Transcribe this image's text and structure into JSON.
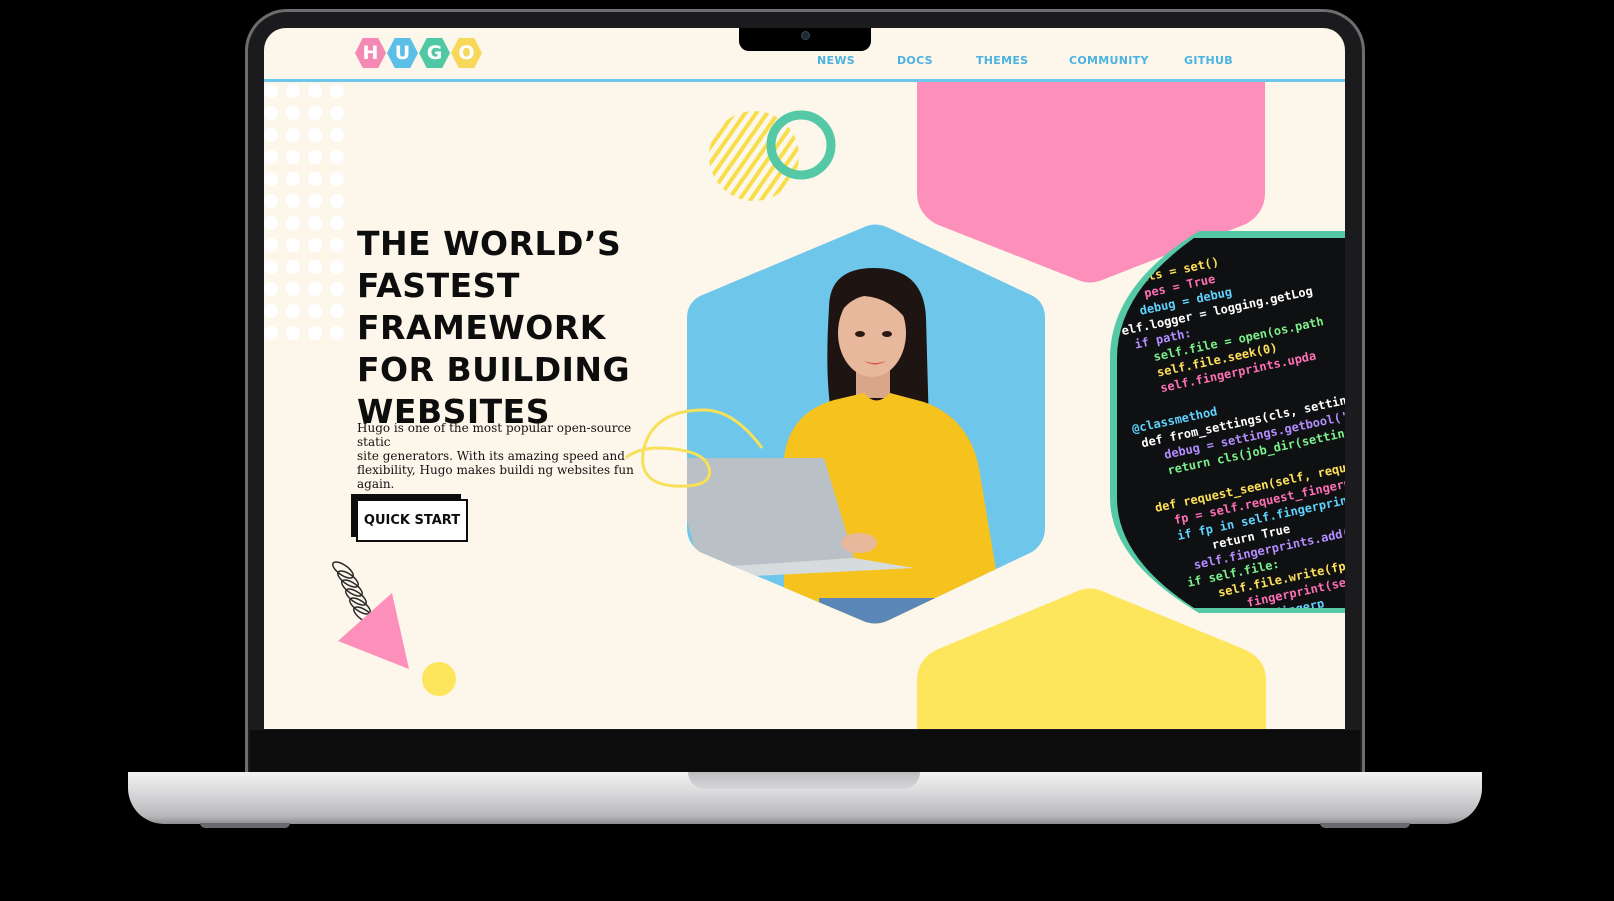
{
  "logo": {
    "letters": [
      "H",
      "U",
      "G",
      "O"
    ],
    "colors": [
      "#f489b6",
      "#5bbfe8",
      "#50c8a4",
      "#f7d85b"
    ]
  },
  "nav": {
    "news": "NEWS",
    "docs": "DOCS",
    "themes": "THEMES",
    "community": "COMMUNITY",
    "github": "GITHUB"
  },
  "hero": {
    "headline_lines": [
      "THE WORLD’S",
      "FASTEST FRAMEWORK",
      "FOR BUILDING",
      "WEBSITES"
    ],
    "description_lines": [
      "Hugo is one of the most popular open-source static",
      "site generators. With its amazing speed and",
      "flexibility, Hugo makes buildi ng websites fun again."
    ],
    "cta_label": "QUICK START"
  },
  "colors": {
    "background": "#fdf6ea",
    "pink": "#fd8fbb",
    "blue": "#6ec6ea",
    "green": "#55c9a5",
    "yellow": "#fee65c",
    "nav_text": "#4ab3e0"
  },
  "code_lines": [
    "nts = set()",
    "pes = True",
    "debug = debug",
    "elf.logger = logging.getLog",
    "if path:",
    "self.file = open(os.path",
    "self.file.seek(0)",
    "self.fingerprints.upda",
    "@classmethod",
    "def from_settings(cls, setting",
    "debug = settings.getbool('",
    "return cls(job_dir(setting",
    "def request_seen(self, reques",
    "fp = self.request_fingerp",
    "if fp in self.fingerprint",
    "return True",
    "self.fingerprints.add(fp",
    "if self.file:",
    "self.file.write(fp",
    "fingerprint(sel",
    "est_fingerp"
  ]
}
